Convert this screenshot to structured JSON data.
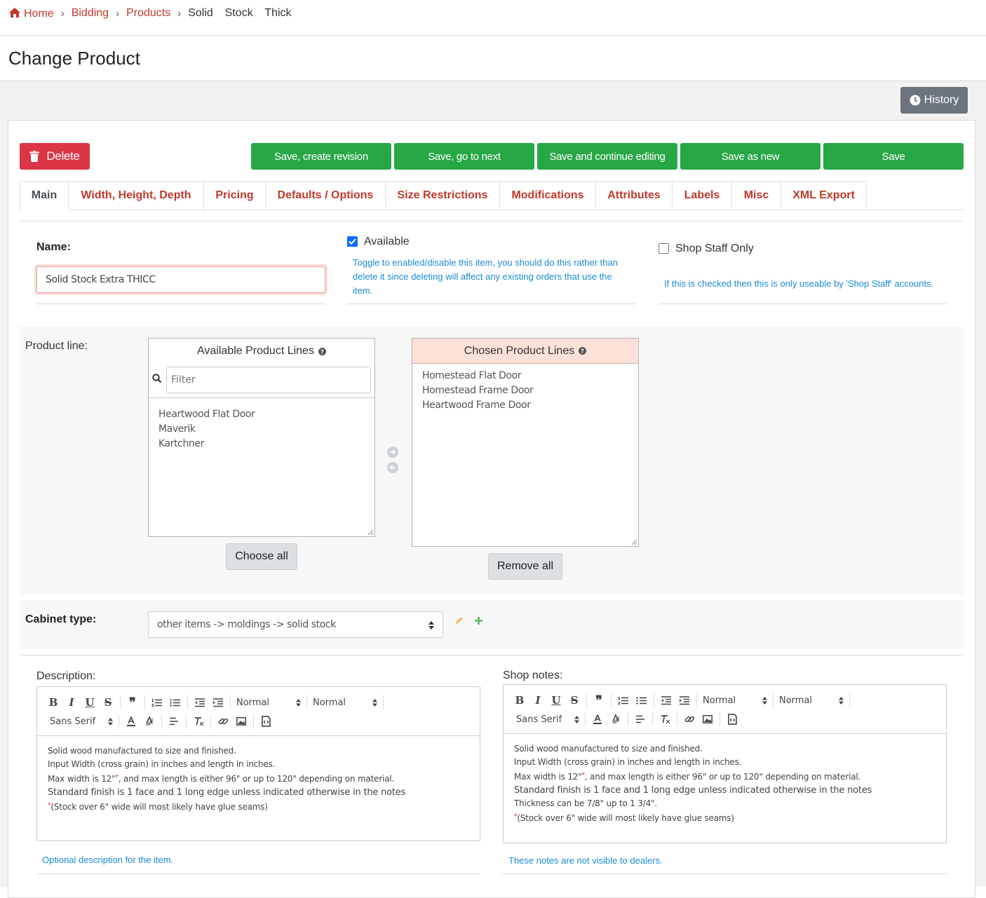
{
  "breadcrumb": {
    "home": "Home",
    "items": [
      "Bidding",
      "Products"
    ],
    "current": "Solid  Stock  Thick",
    "separator": "›"
  },
  "page_title": "Change Product",
  "history_label": "History",
  "actions": {
    "delete": "Delete",
    "save_create_revision": "Save, create revision",
    "save_go_next": "Save, go to next",
    "save_continue": "Save and continue editing",
    "save_as_new": "Save as new",
    "save": "Save"
  },
  "tabs": [
    "Main",
    "Width, Height, Depth",
    "Pricing",
    "Defaults / Options",
    "Size Restrictions",
    "Modifications",
    "Attributes",
    "Labels",
    "Misc",
    "XML Export"
  ],
  "name_field": {
    "label": "Name:",
    "value": "Solid Stock Extra THICC"
  },
  "available": {
    "label": "Available",
    "checked": true,
    "help": "Toggle to enabled/disable this item, you should do this rather than delete it since deleting will affect any existing orders that use the item."
  },
  "shop_staff": {
    "label": "Shop Staff Only",
    "checked": false,
    "help": "If this is checked then this is only useable by 'Shop Staff' accounts."
  },
  "product_line": {
    "label": "Product line:",
    "available_title": "Available Product Lines",
    "filter_placeholder": "Filter",
    "available_items": [
      "Heartwood Flat Door",
      "Maverik",
      "Kartchner"
    ],
    "chosen_title": "Chosen Product Lines",
    "chosen_items": [
      "Homestead Flat Door",
      "Homestead Frame Door",
      "Heartwood Frame Door"
    ],
    "choose_all": "Choose all",
    "remove_all": "Remove all"
  },
  "cabinet_type": {
    "label": "Cabinet type:",
    "value": "other items -> moldings -> solid stock"
  },
  "toolbar": {
    "header_select": "Normal",
    "size_select": "Normal",
    "font_select": "Sans Serif"
  },
  "description": {
    "label": "Description:",
    "lines": [
      "Solid wood manufactured to size and finished.",
      "Input Width (cross grain) in inches and length in inches.",
      "Max width is 12\"",
      ", and max length is either 96\" or up to 120\" depending on material.",
      "Standard finish is 1 face and 1 long edge unless indicated otherwise in the notes",
      "(Stock over 6\" wide will most likely have glue seams)"
    ],
    "marker": "*",
    "help": "Optional description for the item."
  },
  "shop_notes": {
    "label": "Shop notes:",
    "lines": [
      "Solid wood manufactured to size and finished.",
      "Input Width (cross grain) in inches and length in inches.",
      "Max width is 12\"",
      ", and max length is either 96\" or up to 120\" depending on material.",
      "Standard finish is 1 face and 1 long edge unless indicated otherwise in the notes",
      "Thickness can be 7/8\" up to 1 3/4\".",
      "(Stock over 6\" wide will most likely have glue seams)"
    ],
    "marker": "*",
    "help": "These notes are not visible to dealers."
  },
  "colors": {
    "link_red": "#c0392b",
    "green": "#28a745",
    "danger": "#dc3545",
    "help_blue": "#1a8ad4",
    "chosen_header": "#fde0d8"
  }
}
